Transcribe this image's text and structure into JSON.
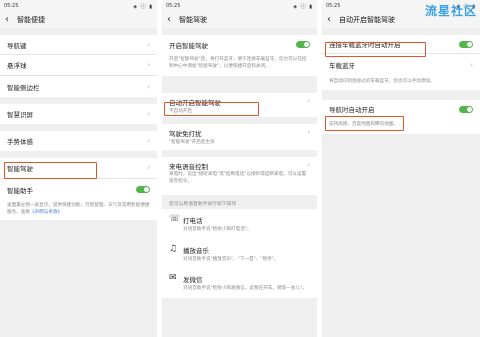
{
  "watermark": "流星社区",
  "panel1": {
    "status_time": "05:25",
    "status_icons": "◈ ⓘ ▮",
    "title": "智能便捷",
    "items": [
      {
        "label": "导航键"
      },
      {
        "label": "悬浮球"
      },
      {
        "label": "智能侧边栏"
      },
      {
        "label": "智慧识屏"
      },
      {
        "label": "手势体感"
      },
      {
        "label": "智能驾驶"
      },
      {
        "label": "智能助手"
      }
    ],
    "assistant_desc": "桌面最左侧一屏显示，提供快捷功能、行程管理、天气及常用智能便捷服务。查看",
    "assistant_link": "《声明与条款》"
  },
  "panel2": {
    "status_time": "05:25",
    "status_icons": "◈ ⓘ ▮",
    "title": "智能驾驶",
    "enable_label": "开启智能驾驶",
    "enable_desc": "开启\"智能驾驶\"后，将打开蓝牙，便于连接车载蓝牙。您也可以在控制中心中添加\"智能驾驶\"，以便快捷开启和关闭。",
    "auto_label": "自动开启智能驾驶",
    "auto_sub": "不自动开启",
    "handsfree_label": "驾驶免打扰",
    "handsfree_sub": "\"智能驾驶\"开启后生效",
    "call_label": "来电语音控制",
    "call_desc": "来电时，说出\"接听来电\"或\"挂断电话\"以接听或挂断来电，可以设置语音指令。",
    "voice_head": "您可以用语音助手进行如下操作",
    "voice_items": [
      {
        "icon": "☏",
        "title": "打电话",
        "desc": "对语音助手说\"给张小阳打电话\"。"
      },
      {
        "icon": "♫",
        "title": "播放音乐",
        "desc": "对语音助手说\"播放音乐\"、\"下一首\"、\"暂停\"。"
      },
      {
        "icon": "✉",
        "title": "发微信",
        "desc": "对语音助手说\"给张小阳发微信，说我在开车，稍等一会儿\"。"
      }
    ]
  },
  "panel3": {
    "status_time": "05:25",
    "status_icons": "◈ ⓘ ▮",
    "title": "自动开启智能驾驶",
    "bt_label": "连接车载蓝牙时自动开启",
    "car_bt_label": "车载蓝牙",
    "car_bt_desc": "将自动识别连接过的车载蓝牙，您也可以手动添加。",
    "nav_label": "导航时自动开启",
    "nav_desc": "支持高德、百度地图和腾讯地图。"
  },
  "colors": {
    "toggle_on": "#52b44a",
    "highlight": "#e2562a",
    "link": "#3a7bd5",
    "watermark": "#3aa0e8"
  }
}
